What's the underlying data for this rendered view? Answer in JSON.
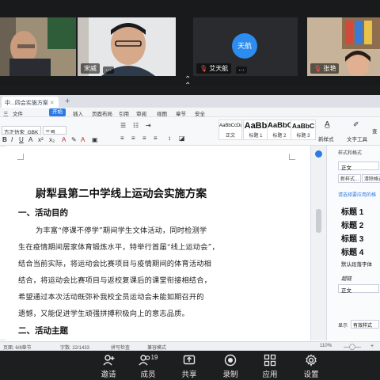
{
  "video_tiles": [
    {
      "name": "",
      "more": ""
    },
    {
      "name": "宋威",
      "more": "···"
    },
    {
      "name": "艾天航",
      "more": "···",
      "avatar_text": "天航",
      "avatar_color": "#2d8cf0"
    },
    {
      "name": "张艳",
      "more": "···"
    }
  ],
  "collapse_icon": "chevron-up",
  "editor": {
    "doc_tab": "中...四会实施方案",
    "menu": [
      "三",
      "文件",
      "开始",
      "插入",
      "页面布局",
      "引用",
      "审阅",
      "视图",
      "章节",
      "安全"
    ],
    "font_name": "方正仿宋_GBK",
    "font_size": "三号",
    "styles": [
      {
        "preview": "AaBbCcDd",
        "label": "正文"
      },
      {
        "preview": "AaBb",
        "label": "标题 1"
      },
      {
        "preview": "AaBbC",
        "label": "标题 2"
      },
      {
        "preview": "AaBbC",
        "label": "标题 3"
      }
    ],
    "new_style": "新样式",
    "text_tools": "文字工具",
    "find": "查"
  },
  "document": {
    "title": "尉犁县第二中学线上运动会实施方案",
    "h1": "一、活动目的",
    "lines": [
      "为丰富“停课不停学”期间学生文体活动，同时检测学",
      "生在疫情期间居家体育锻炼水平，特举行首届“线上运动会”，",
      "结合当前实际，将运动会比赛项目与疫情期间的体育活动相",
      "结合，将运动会比赛项目与返校复课后的课堂衔接相结合，",
      "希望通过本次活动既弥补我校全员运动会未能如期召开的",
      "遗憾，又能促进学生顽强拼搏积极向上的意志品质。"
    ],
    "h2": "二、活动主题"
  },
  "style_panel": {
    "title": "样式和格式",
    "current": "正文",
    "new_btn": "新样式...",
    "clear_btn": "清除格式",
    "hint": "请选择要应用的格",
    "items": [
      "标题 1",
      "标题 2",
      "标题 3",
      "标题 4"
    ],
    "default_font": "默认段落字体",
    "link": "超链",
    "zhengwen": "正文",
    "show_label": "显示",
    "show_value": "有效样式"
  },
  "status": {
    "pages": "页面: 6/8章节",
    "words": "字数: 22/1433",
    "spell": "拼写检查",
    "compat": "兼容模式",
    "zoom": "110%"
  },
  "bottom_bar": [
    {
      "label": "邀请",
      "icon": "invite-icon"
    },
    {
      "label": "成员",
      "icon": "members-icon",
      "count": "19"
    },
    {
      "label": "共享",
      "icon": "share-icon"
    },
    {
      "label": "录制",
      "icon": "record-icon"
    },
    {
      "label": "应用",
      "icon": "apps-icon"
    },
    {
      "label": "设置",
      "icon": "gear-icon"
    }
  ]
}
